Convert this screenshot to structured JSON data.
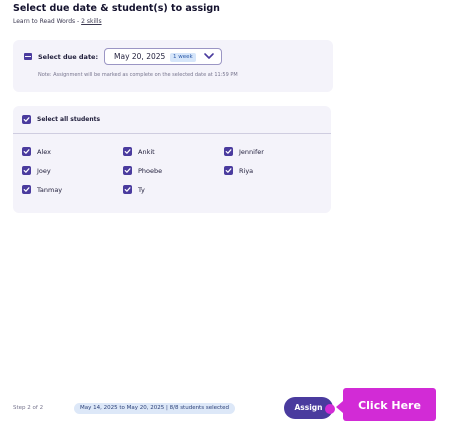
{
  "header": {
    "title": "Select due date & student(s) to assign",
    "subtitle_prefix": "Learn to Read Words - ",
    "skills_link": "2 skills"
  },
  "due_date": {
    "label": "Select due date:",
    "value": "May 20, 2025",
    "duration_chip": "1 week",
    "note": "Note: Assignment will be marked as complete on the selected date at 11:59 PM"
  },
  "students": {
    "select_all_label": "Select all students",
    "select_all_checked": true,
    "list": [
      {
        "name": "Alex",
        "checked": true
      },
      {
        "name": "Ankit",
        "checked": true
      },
      {
        "name": "Jennifer",
        "checked": true
      },
      {
        "name": "Joey",
        "checked": true
      },
      {
        "name": "Phoebe",
        "checked": true
      },
      {
        "name": "Riya",
        "checked": true
      },
      {
        "name": "Tanmay",
        "checked": true
      },
      {
        "name": "Ty",
        "checked": true
      }
    ]
  },
  "footer": {
    "step": "Step 2 of 2",
    "summary": "May 14, 2025 to May 20, 2025 | 8/8 students selected",
    "assign_label": "Assign"
  },
  "callout": {
    "label": "Click Here"
  },
  "colors": {
    "accent": "#4a3b9e",
    "callout": "#d22bd6",
    "chip_bg": "#d6e6fa"
  }
}
